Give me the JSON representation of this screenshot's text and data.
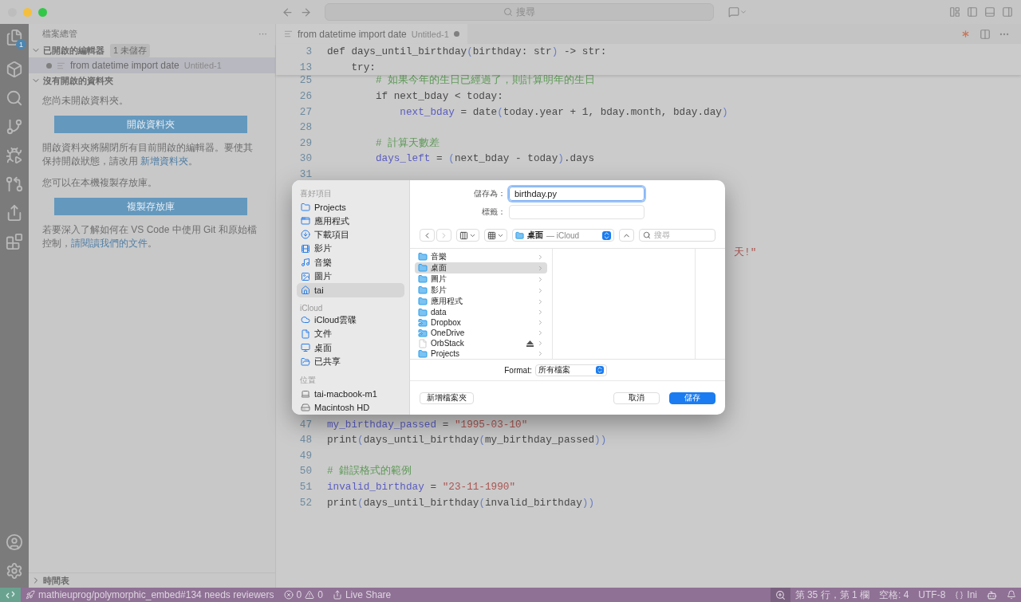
{
  "title_bar": {
    "search": {
      "placeholder": "搜尋"
    }
  },
  "activity_bar": {
    "explorer_badge": "1"
  },
  "sidebar": {
    "title": "檔案總管",
    "more": "···",
    "open_editors": {
      "title": "已開啟的編輯器",
      "expanded": true,
      "badge": "1 未儲存",
      "items": [
        {
          "name": "from datetime import date",
          "detail": "Untitled-1",
          "dirty": true,
          "selected": true
        }
      ]
    },
    "no_folder": {
      "title": "沒有開啟的資料夾",
      "expanded": true,
      "message": "您尚未開啟資料夾。",
      "open_button": "開啟資料夾",
      "paragraph_1": {
        "before": "開啟資料夾將關閉所有目前開啟的編輯器。要使其保持開啟狀態，請改用 ",
        "link": "新增資料夾",
        "after": "。"
      },
      "clone_message": "您可以在本機複製存放庫。",
      "clone_button": "複製存放庫",
      "paragraph_2": {
        "before": "若要深入了解如何在 VS Code 中使用 Git 和原始檔控制，",
        "link": "請閱讀我們的文件",
        "after": "。"
      }
    },
    "timeline": {
      "title": "時間表",
      "expanded": false
    }
  },
  "editor": {
    "tabs": [
      {
        "name": "from datetime import date",
        "detail": "Untitled-1",
        "dirty": true,
        "selected": true
      }
    ],
    "sticky_lines": [
      {
        "number": "3",
        "tokens": [
          {
            "kind": "plain",
            "text": "def days_until_birthday"
          },
          {
            "kind": "paren",
            "text": "("
          },
          {
            "kind": "plain",
            "text": "birthday: str"
          },
          {
            "kind": "paren",
            "text": ")"
          },
          {
            "kind": "plain",
            "text": " -> str:"
          }
        ]
      },
      {
        "number": "13",
        "tokens": [
          {
            "kind": "plain",
            "text": "    try:"
          }
        ]
      }
    ],
    "lines": [
      {
        "kind": "code",
        "number": "25",
        "tokens": [
          {
            "kind": "comment",
            "text": "        # 如果今年的生日已經過了，則計算明年的生日"
          }
        ]
      },
      {
        "kind": "code",
        "number": "26",
        "tokens": [
          {
            "kind": "plain",
            "text": "        if next_bday < today:"
          }
        ]
      },
      {
        "kind": "code",
        "number": "27",
        "tokens": [
          {
            "kind": "var",
            "text": "            next_bday"
          },
          {
            "kind": "plain",
            "text": " = date"
          },
          {
            "kind": "paren",
            "text": "("
          },
          {
            "kind": "plain",
            "text": "today.year + 1, bday.month, bday.day"
          },
          {
            "kind": "paren",
            "text": ")"
          }
        ]
      },
      {
        "kind": "code",
        "number": "28"
      },
      {
        "kind": "code",
        "number": "29",
        "tokens": [
          {
            "kind": "comment",
            "text": "        # 計算天數差"
          }
        ]
      },
      {
        "kind": "code",
        "number": "30",
        "tokens": [
          {
            "kind": "var",
            "text": "        days_left"
          },
          {
            "kind": "plain",
            "text": " = "
          },
          {
            "kind": "paren",
            "text": "("
          },
          {
            "kind": "plain",
            "text": "next_bday - today"
          },
          {
            "kind": "paren",
            "text": ")"
          },
          {
            "kind": "plain",
            "text": ".days"
          }
        ]
      },
      {
        "kind": "code",
        "number": "31"
      },
      {
        "kind": "hidden"
      },
      {
        "kind": "hidden"
      },
      {
        "kind": "hidden"
      },
      {
        "kind": "hidden"
      },
      {
        "kind": "fragment",
        "tokens": [
          {
            "kind": "string",
            "text": "天!\""
          }
        ]
      },
      {
        "kind": "hidden"
      },
      {
        "kind": "hidden"
      },
      {
        "kind": "hidden"
      },
      {
        "kind": "hidden"
      },
      {
        "kind": "hidden"
      },
      {
        "kind": "hidden"
      },
      {
        "kind": "hidden"
      },
      {
        "kind": "hidden"
      },
      {
        "kind": "hidden"
      },
      {
        "kind": "hidden"
      },
      {
        "kind": "code",
        "number": "47",
        "tokens": [
          {
            "kind": "var",
            "text": "my_birthday_passed"
          },
          {
            "kind": "plain",
            "text": " = "
          },
          {
            "kind": "string",
            "text": "\"1995-03-10\""
          }
        ]
      },
      {
        "kind": "code",
        "number": "48",
        "tokens": [
          {
            "kind": "plain",
            "text": "print"
          },
          {
            "kind": "paren",
            "text": "("
          },
          {
            "kind": "plain",
            "text": "days_until_birthday"
          },
          {
            "kind": "paren",
            "text": "("
          },
          {
            "kind": "plain",
            "text": "my_birthday_passed"
          },
          {
            "kind": "paren",
            "text": "))"
          }
        ]
      },
      {
        "kind": "code",
        "number": "49"
      },
      {
        "kind": "code",
        "number": "50",
        "tokens": [
          {
            "kind": "comment",
            "text": "# 錯誤格式的範例"
          }
        ]
      },
      {
        "kind": "code",
        "number": "51",
        "tokens": [
          {
            "kind": "var",
            "text": "invalid_birthday"
          },
          {
            "kind": "plain",
            "text": " = "
          },
          {
            "kind": "string",
            "text": "\"23-11-1990\""
          }
        ]
      },
      {
        "kind": "code",
        "number": "52",
        "tokens": [
          {
            "kind": "plain",
            "text": "print"
          },
          {
            "kind": "paren",
            "text": "("
          },
          {
            "kind": "plain",
            "text": "days_until_birthday"
          },
          {
            "kind": "paren",
            "text": "("
          },
          {
            "kind": "plain",
            "text": "invalid_birthday"
          },
          {
            "kind": "paren",
            "text": "))"
          }
        ]
      }
    ]
  },
  "save_dialog": {
    "sidebar": [
      {
        "heading": "喜好項目",
        "items": [
          {
            "label": "Projects",
            "selected": false
          },
          {
            "label": "應用程式",
            "selected": false
          },
          {
            "label": "下載項目",
            "selected": false
          },
          {
            "label": "影片",
            "selected": false
          },
          {
            "label": "音樂",
            "selected": false
          },
          {
            "label": "圖片",
            "selected": false
          },
          {
            "label": "tai",
            "selected": true
          }
        ]
      },
      {
        "heading": "iCloud",
        "items": [
          {
            "label": "iCloud雲碟",
            "selected": false
          },
          {
            "label": "文件",
            "selected": false
          },
          {
            "label": "桌面",
            "selected": false
          },
          {
            "label": "已共享",
            "selected": false
          }
        ]
      },
      {
        "heading": "位置",
        "items": [
          {
            "label": "tai-macbook-m1",
            "selected": false
          },
          {
            "label": "Macintosh HD",
            "selected": false
          }
        ]
      }
    ],
    "save_as": {
      "label": "儲存為：",
      "value": "birthday.py",
      "focused": true
    },
    "tags": {
      "label": "標籤："
    },
    "location": {
      "folder": "桌面",
      "place": "— iCloud"
    },
    "search": {
      "placeholder": "搜尋"
    },
    "files": [
      {
        "name": "音樂",
        "kind": "folder",
        "selected": false,
        "ejectable": false
      },
      {
        "name": "桌面",
        "kind": "folder",
        "selected": true,
        "ejectable": false
      },
      {
        "name": "圖片",
        "kind": "folder",
        "selected": false,
        "ejectable": false
      },
      {
        "name": "影片",
        "kind": "folder",
        "selected": false,
        "ejectable": false
      },
      {
        "name": "應用程式",
        "kind": "folder",
        "selected": false,
        "ejectable": false
      },
      {
        "name": "data",
        "kind": "folder",
        "selected": false,
        "ejectable": false
      },
      {
        "name": "Dropbox",
        "kind": "alias",
        "selected": false,
        "ejectable": false
      },
      {
        "name": "OneDrive",
        "kind": "alias",
        "selected": false,
        "ejectable": false
      },
      {
        "name": "OrbStack",
        "kind": "file",
        "selected": false,
        "ejectable": true
      },
      {
        "name": "Projects",
        "kind": "folder",
        "selected": false,
        "ejectable": false
      }
    ],
    "format": {
      "label": "Format:",
      "value": "所有檔案"
    },
    "new_folder_button": "新增檔案夾",
    "buttons": [
      {
        "label": "取消",
        "primary": false
      },
      {
        "label": "儲存",
        "primary": true
      }
    ]
  },
  "status_bar": {
    "branch": "mathieuprog/polymorphic_embed#134 needs reviewers",
    "errors": "0",
    "warnings": "0",
    "live_share": "Live Share",
    "position": "第 35 行，第 1 欄",
    "spaces": "空格: 4",
    "encoding": "UTF-8",
    "language": "Ini"
  }
}
